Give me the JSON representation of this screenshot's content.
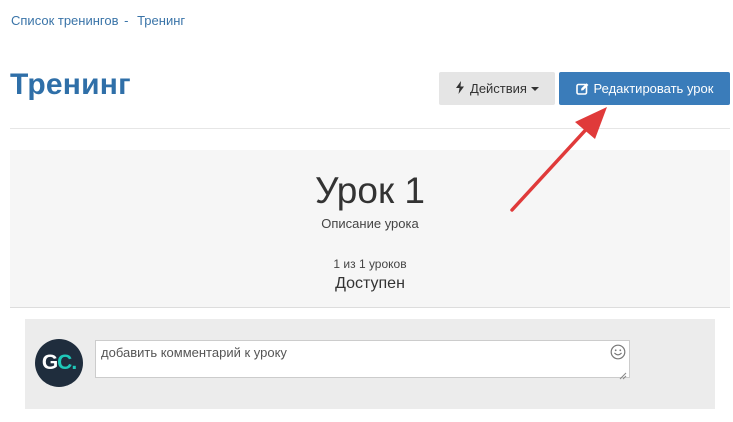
{
  "breadcrumb": {
    "items": [
      {
        "label": "Список тренингов"
      },
      {
        "label": "Тренинг"
      }
    ],
    "separator": "-"
  },
  "header": {
    "title": "Тренинг",
    "actions_label": "Действия",
    "edit_label": "Редактировать урок"
  },
  "lesson": {
    "title": "Урок 1",
    "description": "Описание урока",
    "progress": "1 из 1 уроков",
    "status": "Доступен"
  },
  "comment": {
    "placeholder": "добавить комментарий к уроку",
    "avatar_letters": [
      "G",
      "C",
      "."
    ]
  },
  "icons": {
    "actions": "lightning-bolt-icon",
    "edit": "pencil-square-icon",
    "emoji": "smiley-face-icon"
  },
  "colors": {
    "accent": "#3a7cba",
    "title": "#2f6fa8",
    "link": "#3a74a8",
    "avatar_bg": "#1f2d3d",
    "avatar_accent": "#1fc8b9",
    "annotation_arrow": "#e03a3a"
  }
}
